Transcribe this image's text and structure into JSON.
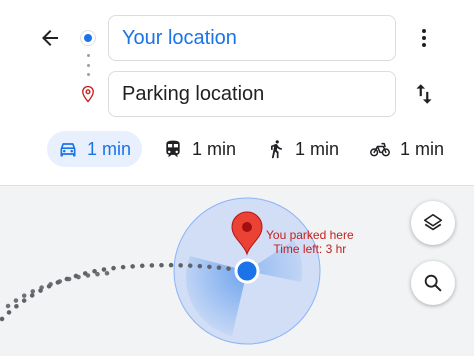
{
  "header": {
    "origin": {
      "value": "Your location"
    },
    "destination": {
      "value": "Parking location"
    }
  },
  "modes": [
    {
      "id": "drive",
      "icon": "car-icon",
      "time": "1 min",
      "active": true
    },
    {
      "id": "transit",
      "icon": "train-icon",
      "time": "1 min",
      "active": false
    },
    {
      "id": "walk",
      "icon": "walking-icon",
      "time": "1 min",
      "active": false
    },
    {
      "id": "bike",
      "icon": "bicycle-icon",
      "time": "1 min",
      "active": false
    }
  ],
  "map": {
    "parked_label": "You parked here",
    "time_left": "Time left: 3 hr",
    "colors": {
      "accent": "#1a73e8",
      "pin": "#ea4335",
      "label": "#c5221f",
      "route_dots": "#5f6368",
      "map_background": "#f1f3f4"
    }
  }
}
